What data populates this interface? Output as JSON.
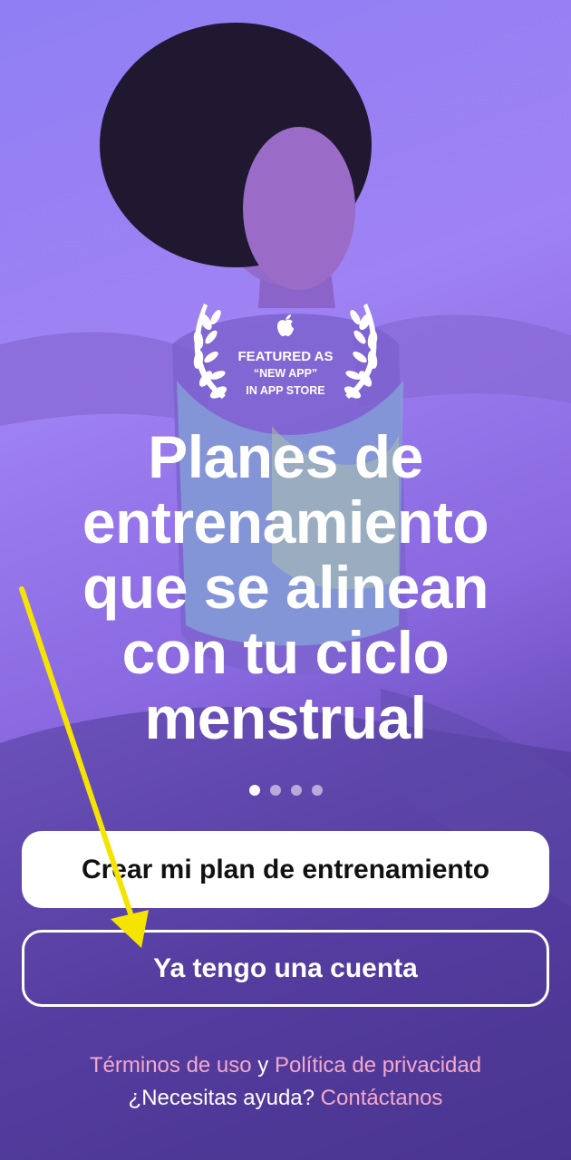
{
  "badge": {
    "line1": "FEATURED AS",
    "line2": "“NEW APP”",
    "line3": "IN APP STORE",
    "icon": "apple-logo-icon"
  },
  "headline": {
    "line1": "Planes de",
    "line2": "entrenamiento",
    "line3": "que se alinean",
    "line4": "con tu ciclo",
    "line5": "menstrual"
  },
  "pager": {
    "count": 4,
    "active_index": 0
  },
  "buttons": {
    "primary_label": "Crear mi plan de entrenamiento",
    "secondary_label": "Ya tengo una cuenta"
  },
  "footer": {
    "terms_link": "Términos de uso",
    "and_word": "y",
    "privacy_link": "Política de privacidad",
    "help_text": "¿Necesitas ayuda?",
    "contact_link": "Contáctanos"
  },
  "colors": {
    "background_top": "#9f82f3",
    "background_bottom": "#442f87",
    "primary_button_bg": "#ffffff",
    "link_color": "#f4a9c9",
    "annotation_arrow": "#f5e400"
  }
}
